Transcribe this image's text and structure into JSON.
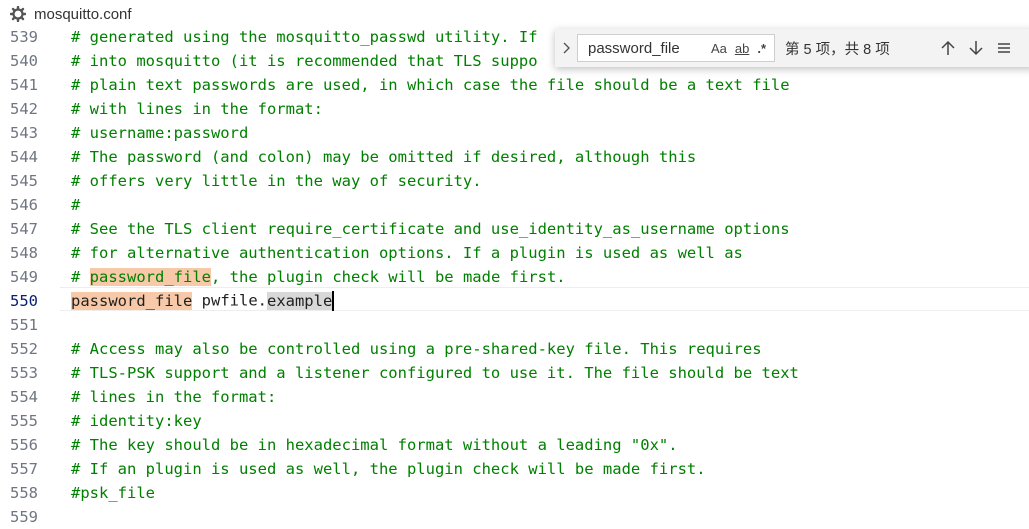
{
  "tab": {
    "filename": "mosquitto.conf",
    "icon": "gear-icon"
  },
  "find": {
    "query": "password_file",
    "opt_case": "Aa",
    "opt_word": "ab",
    "opt_regex": ".*",
    "count": "第 5 项，共 8 项",
    "toggle_icon": "chevron-right-icon",
    "prev_icon": "arrow-up-icon",
    "next_icon": "arrow-down-icon",
    "menu_icon": "menu-icon"
  },
  "lines": [
    {
      "num": "539",
      "text": "# generated using the mosquitto_passwd utility. If"
    },
    {
      "num": "540",
      "text": "# into mosquitto (it is recommended that TLS suppo"
    },
    {
      "num": "541",
      "text": "# plain text passwords are used, in which case the file should be a text file"
    },
    {
      "num": "542",
      "text": "# with lines in the format:"
    },
    {
      "num": "543",
      "text": "# username:password"
    },
    {
      "num": "544",
      "text": "# The password (and colon) may be omitted if desired, although this"
    },
    {
      "num": "545",
      "text": "# offers very little in the way of security."
    },
    {
      "num": "546",
      "text": "#"
    },
    {
      "num": "547",
      "text": "# See the TLS client require_certificate and use_identity_as_username options"
    },
    {
      "num": "548",
      "text": "# for alternative authentication options. If a plugin is used as well as"
    },
    {
      "num": "549",
      "pre": "# ",
      "match": "password_file",
      "post": ", the plugin check will be made first."
    },
    {
      "num": "550",
      "key": "password_file",
      "mid": " pwfile.",
      "sel": "example"
    },
    {
      "num": "551",
      "text": ""
    },
    {
      "num": "552",
      "text": "# Access may also be controlled using a pre-shared-key file. This requires"
    },
    {
      "num": "553",
      "text": "# TLS-PSK support and a listener configured to use it. The file should be text"
    },
    {
      "num": "554",
      "text": "# lines in the format:"
    },
    {
      "num": "555",
      "text": "# identity:key"
    },
    {
      "num": "556",
      "text": "# The key should be in hexadecimal format without a leading \"0x\"."
    },
    {
      "num": "557",
      "text": "# If an plugin is used as well, the plugin check will be made first."
    },
    {
      "num": "558",
      "text": "#psk_file"
    },
    {
      "num": "559",
      "text": ""
    }
  ]
}
